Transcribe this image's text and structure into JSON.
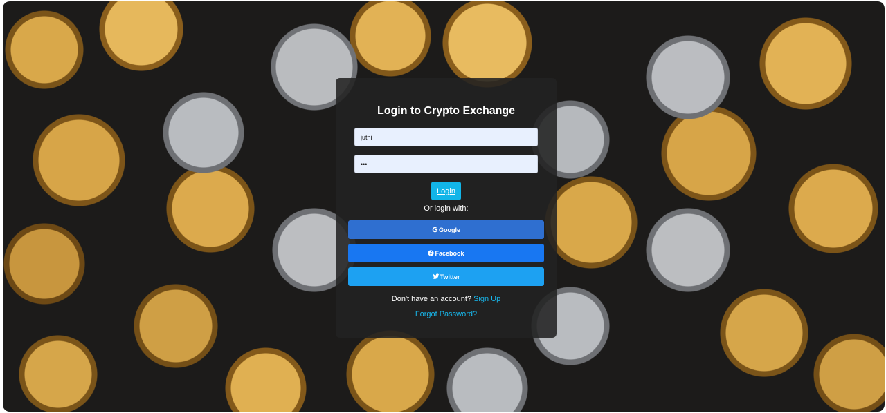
{
  "login_form": {
    "title": "Login to Crypto Exchange",
    "username_value": "juthi",
    "password_value": "•••",
    "login_label": "Login",
    "or_text": "Or login with:"
  },
  "social": {
    "google_label": "Google",
    "google_icon": "google-icon",
    "google_color": "#2f6fd0",
    "facebook_label": "Facebook",
    "facebook_icon": "facebook-icon",
    "facebook_color": "#1877f2",
    "twitter_label": "Twitter",
    "twitter_icon": "twitter-icon",
    "twitter_color": "#1da1f2"
  },
  "footer": {
    "signup_prompt": "Don't have an account?",
    "signup_link": "Sign Up",
    "forgot_link": "Forgot Password?"
  },
  "colors": {
    "accent": "#12b5e8",
    "link": "#18b6ea",
    "card_background": "#222222"
  }
}
